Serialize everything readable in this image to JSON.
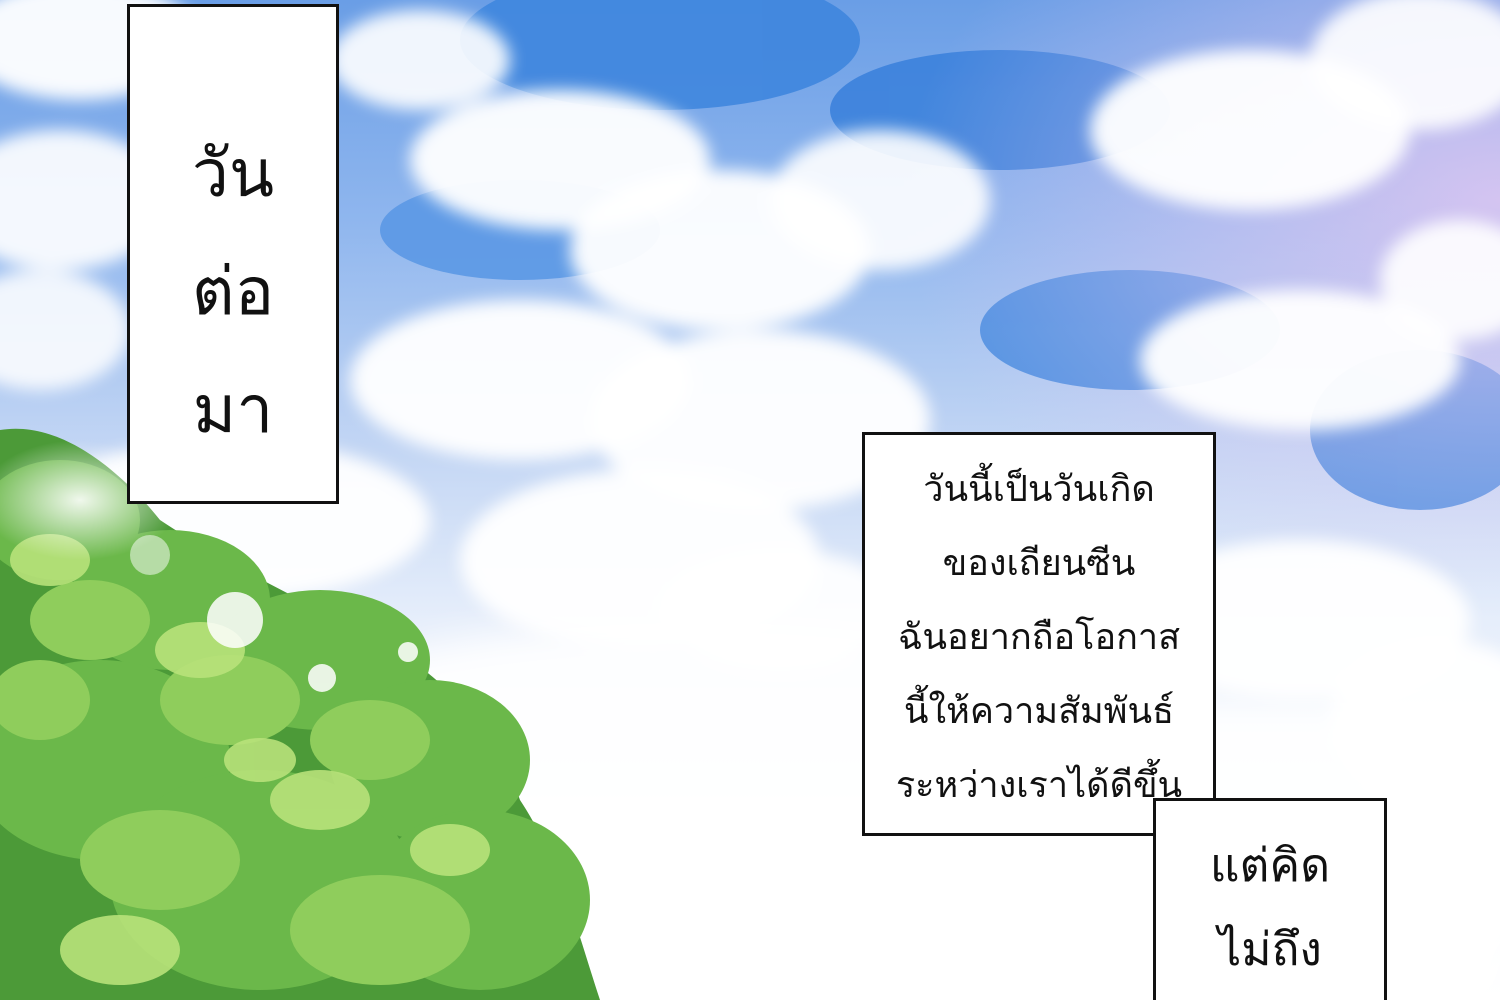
{
  "captions": {
    "left_vertical": {
      "lines": [
        "วัน",
        "ต่อ",
        "มา"
      ]
    },
    "right_main": {
      "lines": [
        "วันนี้เป็นวันเกิด",
        "ของเถียนซีน",
        "ฉันอยากถือโอกาส",
        "นี้ให้ความสัมพันธ์",
        "ระหว่างเราได้ดีขึ้น"
      ]
    },
    "right_small": {
      "lines": [
        "แต่คิด",
        "ไม่ถึง"
      ]
    }
  },
  "colors": {
    "sky_top": "#6a9ee6",
    "sky_bottom": "#ffffff",
    "foliage_dark": "#4c9a38",
    "foliage_light": "#b8e27a",
    "caption_bg": "#ffffff",
    "caption_border": "#111111"
  }
}
